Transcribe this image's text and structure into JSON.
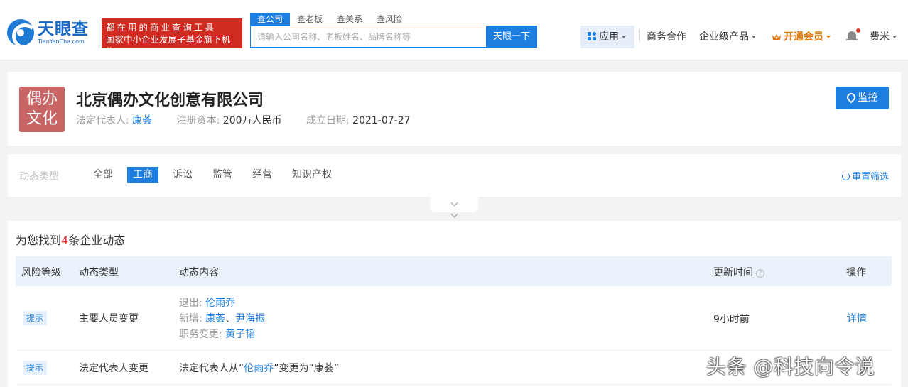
{
  "header": {
    "logo_cn": "天眼查",
    "logo_en": "TianYanCha.com",
    "promo_line1": "都在用的商业查询工具",
    "promo_line2": "国家中小企业发展子基金旗下机构",
    "search_tabs": [
      "查公司",
      "查老板",
      "查关系",
      "查风险"
    ],
    "search_placeholder": "请输入公司名称、老板姓名、品牌名称等",
    "search_button": "天眼一下",
    "nav_app": "应用",
    "nav_business": "商务合作",
    "nav_enterprise": "企业级产品",
    "nav_vip": "开通会员",
    "nav_user": "费米"
  },
  "company": {
    "avatar_line1": "偶办",
    "avatar_line2": "文化",
    "name": "北京偶办文化创意有限公司",
    "legal_rep_label": "法定代表人:",
    "legal_rep": "康荟",
    "capital_label": "注册资本:",
    "capital": "200万人民币",
    "founded_label": "成立日期:",
    "founded": "2021-07-27",
    "monitor_button": "监控"
  },
  "filter": {
    "label": "动态类型",
    "tabs": [
      "全部",
      "工商",
      "诉讼",
      "监管",
      "经营",
      "知识产权"
    ],
    "active_index": 1,
    "reset": "重置筛选"
  },
  "results": {
    "prefix": "为您找到",
    "count": "4",
    "suffix": "条企业动态",
    "columns": [
      "风险等级",
      "动态类型",
      "动态内容",
      "更新时间",
      "操作"
    ],
    "rows": [
      {
        "level": "提示",
        "type": "主要人员变更",
        "exit_label": "退出:",
        "exit_names": "伦雨乔",
        "add_label": "新增:",
        "add_name1": "康荟",
        "add_sep": "、",
        "add_name2": "尹海振",
        "role_label": "职务变更:",
        "role_name": "黄子韬",
        "time": "9小时前",
        "action": "详情"
      },
      {
        "level": "提示",
        "type": "法定代表人变更",
        "content_prefix": "法定代表人从“",
        "content_from": "伦雨乔",
        "content_mid": "”变更为“康荟”"
      }
    ]
  },
  "watermark": "头条 @科技向令说"
}
